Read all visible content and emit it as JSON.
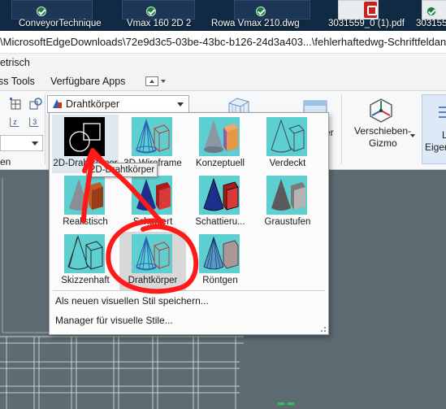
{
  "desktop_files": [
    {
      "label": "ConveyorTechnique"
    },
    {
      "label": "Vmax 160 2D 2"
    },
    {
      "label": "Rowa Vmax 210.dwg"
    },
    {
      "label": "3031559_0 (1).pdf"
    },
    {
      "label": "303155"
    }
  ],
  "title_path": "\\MicrosoftEdgeDownloads\\72e9d3c5-03be-43bc-b126-24d3a403...\\fehlerhaftedwg-Schriftfeldanzeige.dwg",
  "menu": {
    "partial": "etrisch"
  },
  "tabs": [
    "ss Tools",
    "Verfügbare Apps"
  ],
  "ribbon": {
    "combo_value": "Drahtkörper",
    "partial_labels": {
      "left": "en",
      "er": "er",
      "eig_1": "L",
      "eig_2": "Eigen"
    },
    "verschieben": [
      "Verschieben-",
      "Gizmo"
    ]
  },
  "visual_styles": [
    {
      "label": "2D-Drahtkörper",
      "icon": "2d-wireframe-icon"
    },
    {
      "label": "3D-Wireframe",
      "icon": "3d-wireframe-icon"
    },
    {
      "label": "Konzeptuell",
      "icon": "conceptual-icon"
    },
    {
      "label": "Verdeckt",
      "icon": "hidden-icon"
    },
    {
      "label": "Realistisch",
      "icon": "realistic-icon"
    },
    {
      "label": "Schattiert",
      "icon": "shaded-icon"
    },
    {
      "label": "Schattieru...",
      "icon": "shaded-edges-icon"
    },
    {
      "label": "Graustufen",
      "icon": "grayscale-icon"
    },
    {
      "label": "Skizzenhaft",
      "icon": "sketchy-icon"
    },
    {
      "label": "Drahtkörper",
      "icon": "wireframe-icon",
      "selected": true
    },
    {
      "label": "Röntgen",
      "icon": "xray-icon"
    }
  ],
  "actions": {
    "save_new": "Als neuen visuellen Stil speichern...",
    "manager": "Manager für visuelle Stile..."
  },
  "tooltip": "2D-Drahtkörper"
}
